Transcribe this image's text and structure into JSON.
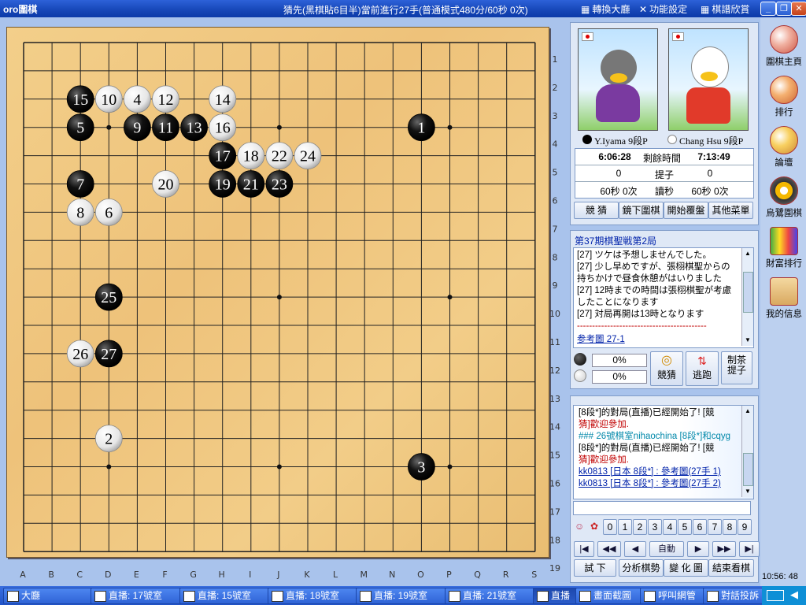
{
  "app": {
    "logo": "oro圍棋",
    "caption": "猜先(黑棋貼6目半)當前進行27手(普通模式480分/60秒 0次)",
    "top_buttons": [
      "轉換大廳",
      "功能設定",
      "棋譜欣賞"
    ]
  },
  "board": {
    "size": 19,
    "col_labels": [
      "A",
      "B",
      "C",
      "D",
      "E",
      "F",
      "G",
      "H",
      "I",
      "J",
      "K",
      "L",
      "M",
      "N",
      "O",
      "P",
      "Q",
      "R",
      "S"
    ],
    "row_labels": [
      "1",
      "2",
      "3",
      "4",
      "5",
      "6",
      "7",
      "8",
      "9",
      "10",
      "11",
      "12",
      "13",
      "14",
      "15",
      "16",
      "17",
      "18",
      "19"
    ],
    "stones": [
      {
        "n": 1,
        "color": "black",
        "col": 15,
        "row": 4
      },
      {
        "n": 2,
        "color": "white",
        "col": 4,
        "row": 15
      },
      {
        "n": 3,
        "color": "black",
        "col": 15,
        "row": 16
      },
      {
        "n": 4,
        "color": "white",
        "col": 5,
        "row": 3
      },
      {
        "n": 5,
        "color": "black",
        "col": 3,
        "row": 4
      },
      {
        "n": 6,
        "color": "white",
        "col": 4,
        "row": 7
      },
      {
        "n": 7,
        "color": "black",
        "col": 3,
        "row": 6
      },
      {
        "n": 8,
        "color": "white",
        "col": 3,
        "row": 7
      },
      {
        "n": 9,
        "color": "black",
        "col": 5,
        "row": 4
      },
      {
        "n": 10,
        "color": "white",
        "col": 4,
        "row": 3
      },
      {
        "n": 11,
        "color": "black",
        "col": 6,
        "row": 4
      },
      {
        "n": 12,
        "color": "white",
        "col": 6,
        "row": 3
      },
      {
        "n": 13,
        "color": "black",
        "col": 7,
        "row": 4
      },
      {
        "n": 14,
        "color": "white",
        "col": 8,
        "row": 3
      },
      {
        "n": 15,
        "color": "black",
        "col": 3,
        "row": 3
      },
      {
        "n": 16,
        "color": "white",
        "col": 8,
        "row": 4
      },
      {
        "n": 17,
        "color": "black",
        "col": 8,
        "row": 5
      },
      {
        "n": 18,
        "color": "white",
        "col": 9,
        "row": 5
      },
      {
        "n": 19,
        "color": "black",
        "col": 8,
        "row": 6
      },
      {
        "n": 20,
        "color": "white",
        "col": 6,
        "row": 6
      },
      {
        "n": 21,
        "color": "black",
        "col": 9,
        "row": 6
      },
      {
        "n": 22,
        "color": "white",
        "col": 10,
        "row": 5
      },
      {
        "n": 23,
        "color": "black",
        "col": 10,
        "row": 6
      },
      {
        "n": 24,
        "color": "white",
        "col": 11,
        "row": 5
      },
      {
        "n": 25,
        "color": "black",
        "col": 4,
        "row": 10
      },
      {
        "n": 26,
        "color": "white",
        "col": 3,
        "row": 12
      },
      {
        "n": 27,
        "color": "black",
        "col": 4,
        "row": 12
      }
    ]
  },
  "players": {
    "black": {
      "name": "Y.Iyama 9段P",
      "time": "6:06:28",
      "captures": "0",
      "byoyomi": "60秒 0次"
    },
    "white": {
      "name": "Chang Hsu 9段P",
      "time": "7:13:49",
      "captures": "0",
      "byoyomi": "60秒 0次"
    },
    "labels": {
      "remaining": "剩餘時間",
      "captures": "提子",
      "byoyomi": "讀秒"
    }
  },
  "action_buttons": [
    "競 猜",
    "鏡下圍棋",
    "開始覆盤",
    "其他菜單"
  ],
  "commentary": {
    "title": "第37期棋聖戦第2局",
    "lines": [
      "[27] ツケは予想しませんでした。",
      "[27] 少し早めですが、張栩棋聖からの",
      "持ちかけで昼食休憩がはいりました",
      "[27] 12時までの時間は張栩棋聖が考慮",
      "したことになります",
      "[27] 対局再開は13時となります",
      "-------------------------------------------",
      "参考圖 27-1"
    ]
  },
  "guess": {
    "black_pct": "0%",
    "white_pct": "0%",
    "buttons": [
      "競猜",
      "逃跑",
      "制茶提子"
    ]
  },
  "chat": {
    "lines": [
      "[8段*]的對局(直播)已經開始了! [競",
      "猜]歡迎參加.",
      "### 26號棋室nihaochina [8段*]和cqyg",
      "[8段*]的對局(直播)已經開始了! [競",
      "猜]歡迎參加.",
      "kk0813 [日本 8段*] : 參考圖(27手 1)",
      "kk0813 [日本 8段*] : 參考圖(27手 2)"
    ],
    "input_value": "",
    "number_keys": [
      "0",
      "1",
      "2",
      "3",
      "4",
      "5",
      "6",
      "7",
      "8",
      "9"
    ]
  },
  "nav": {
    "buttons": [
      "|◀",
      "◀◀",
      "◀",
      "自動",
      "▶",
      "▶▶",
      "▶|"
    ],
    "bottom": [
      "試 下",
      "分析棋勢",
      "變 化 圖",
      "結束看棋"
    ]
  },
  "clock": "10:56: 48",
  "sidebar": [
    "圍棋主頁",
    "排行",
    "論壇",
    "烏鷺圍棋",
    "財富排行",
    "我的信息"
  ],
  "taskbar": [
    "大廳",
    "直播: 17號室",
    "直播: 15號室",
    "直播: 18號室",
    "直播: 19號室",
    "直播: 21號室",
    "直播",
    "畫面截圖",
    "呼叫網管",
    "對話投訴"
  ]
}
